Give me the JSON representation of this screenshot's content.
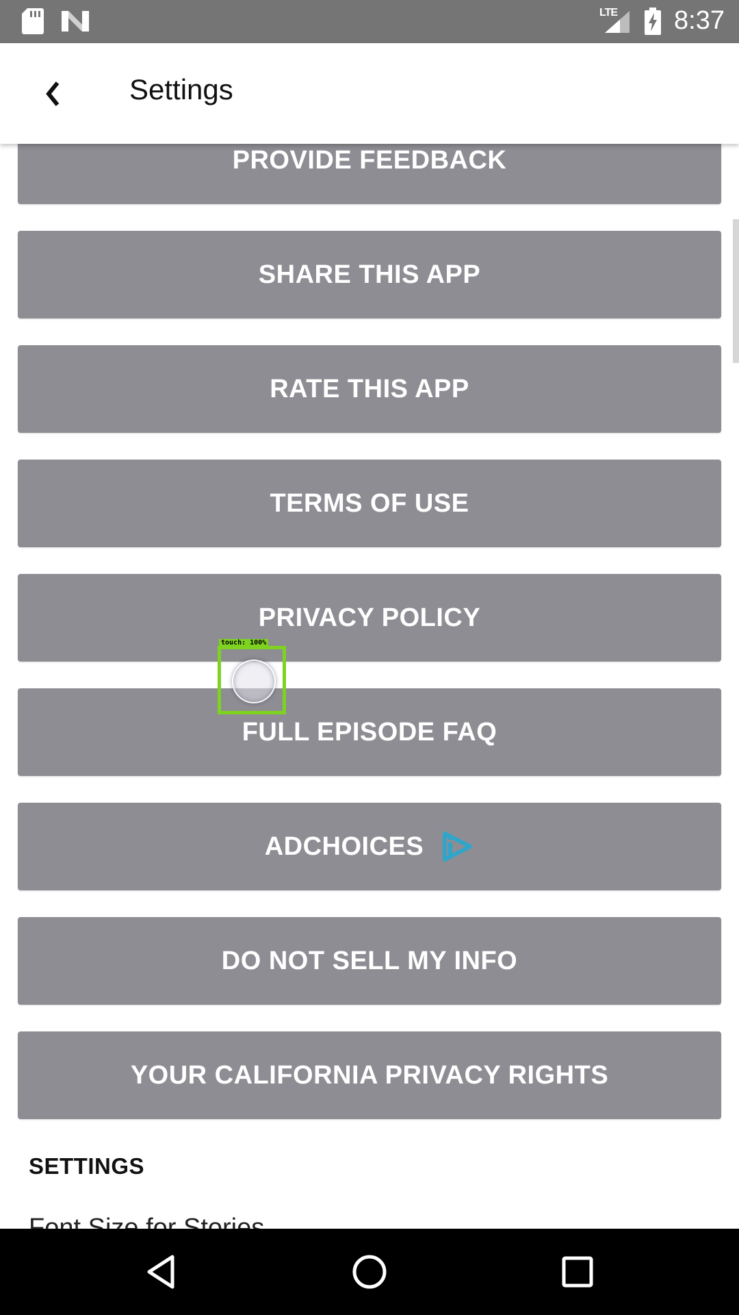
{
  "status_bar": {
    "network_label": "LTE",
    "time": "8:37",
    "icons": [
      "sd-card-icon",
      "n-icon",
      "signal-icon",
      "battery-charging-icon"
    ]
  },
  "header": {
    "back_icon": "chevron-left-icon",
    "title": "Settings"
  },
  "menu_buttons": [
    {
      "label": "PROVIDE FEEDBACK"
    },
    {
      "label": "SHARE THIS APP"
    },
    {
      "label": "RATE THIS APP"
    },
    {
      "label": "TERMS OF USE"
    },
    {
      "label": "PRIVACY POLICY"
    },
    {
      "label": "FULL EPISODE FAQ"
    },
    {
      "label": "ADCHOICES",
      "icon": "adchoices-icon"
    },
    {
      "label": "DO NOT SELL MY INFO"
    },
    {
      "label": "YOUR CALIFORNIA PRIVACY RIGHTS"
    }
  ],
  "settings_section": {
    "heading": "SETTINGS",
    "font_size_label": "Font Size for Stories"
  },
  "touch_overlay": {
    "label": "touch: 100%"
  },
  "nav_bar": {
    "icons": [
      "back-triangle-icon",
      "home-circle-icon",
      "recents-square-icon"
    ]
  },
  "colors": {
    "status_bar": "#757575",
    "button_bg": "#8e8d93",
    "button_text": "#ffffff",
    "adchoices_accent": "#2fa6c9",
    "touch_box": "#7ed321",
    "nav_bar": "#000000"
  }
}
